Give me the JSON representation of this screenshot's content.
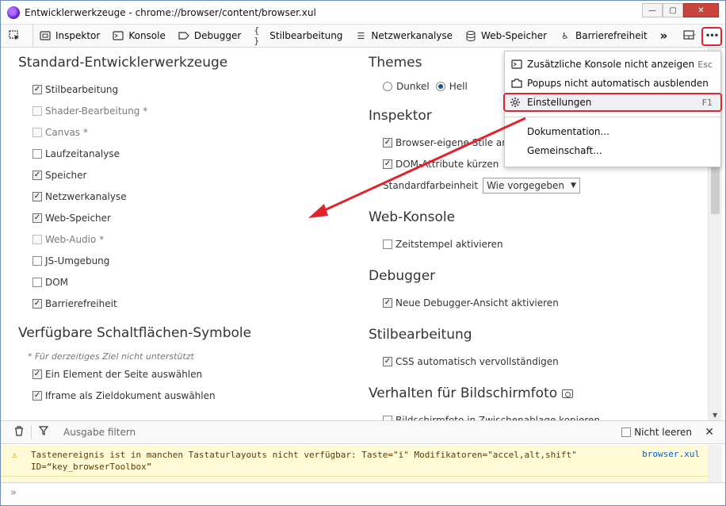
{
  "window": {
    "title": "Entwicklerwerkzeuge - chrome://browser/content/browser.xul",
    "min": "—",
    "max": "▢",
    "close": "✕"
  },
  "toolbar": {
    "tabs": [
      {
        "label": "Inspektor",
        "icon": "inspector-icon"
      },
      {
        "label": "Konsole",
        "icon": "console-icon"
      },
      {
        "label": "Debugger",
        "icon": "debugger-icon"
      },
      {
        "label": "Stilbearbeitung",
        "icon": "style-editor-icon"
      },
      {
        "label": "Netzwerkanalyse",
        "icon": "network-icon"
      },
      {
        "label": "Web-Speicher",
        "icon": "storage-icon"
      },
      {
        "label": "Barrierefreiheit",
        "icon": "accessibility-icon"
      }
    ],
    "overflow": "»",
    "menu_button": "•••"
  },
  "left": {
    "default_tools_title": "Standard-Entwicklerwerkzeuge",
    "default_tools": [
      {
        "label": "Stilbearbeitung",
        "checked": true,
        "disabled": false
      },
      {
        "label": "Shader-Bearbeitung *",
        "checked": false,
        "disabled": true
      },
      {
        "label": "Canvas *",
        "checked": false,
        "disabled": true
      },
      {
        "label": "Laufzeitanalyse",
        "checked": false,
        "disabled": false
      },
      {
        "label": "Speicher",
        "checked": true,
        "disabled": false
      },
      {
        "label": "Netzwerkanalyse",
        "checked": true,
        "disabled": false
      },
      {
        "label": "Web-Speicher",
        "checked": true,
        "disabled": false
      },
      {
        "label": "Web-Audio *",
        "checked": false,
        "disabled": true
      },
      {
        "label": "JS-Umgebung",
        "checked": false,
        "disabled": false
      },
      {
        "label": "DOM",
        "checked": false,
        "disabled": false
      },
      {
        "label": "Barrierefreiheit",
        "checked": true,
        "disabled": false
      }
    ],
    "buttons_title": "Verfügbare Schaltflächen-Symbole",
    "buttons_note": "* Für derzeitiges Ziel nicht unterstützt",
    "buttons": [
      {
        "label": "Ein Element der Seite auswählen",
        "checked": true
      },
      {
        "label": "Iframe als Zieldokument auswählen",
        "checked": true
      }
    ]
  },
  "right": {
    "themes_title": "Themes",
    "themes": [
      {
        "label": "Dunkel",
        "selected": false
      },
      {
        "label": "Hell",
        "selected": true
      }
    ],
    "inspector_title": "Inspektor",
    "inspector": [
      {
        "label": "Browser-eigene Stile anzeigen",
        "checked": true
      },
      {
        "label": "DOM-Attribute kürzen",
        "checked": true
      }
    ],
    "color_unit_label": "Standardfarbeinheit",
    "color_unit_value": "Wie vorgegeben",
    "webconsole_title": "Web-Konsole",
    "webconsole": [
      {
        "label": "Zeitstempel aktivieren",
        "checked": false
      }
    ],
    "debugger_title": "Debugger",
    "debugger": [
      {
        "label": "Neue Debugger-Ansicht aktivieren",
        "checked": true
      }
    ],
    "styleeditor_title": "Stilbearbeitung",
    "styleeditor": [
      {
        "label": "CSS automatisch vervollständigen",
        "checked": true
      }
    ],
    "screenshot_title": "Verhalten für Bildschirmfoto",
    "screenshot": [
      {
        "label": "Bildschirmfoto in Zwischenablage kopieren",
        "checked": false
      }
    ]
  },
  "menu": {
    "items": [
      {
        "label": "Zusätzliche Konsole nicht anzeigen",
        "key": "Esc",
        "icon": "split-console-icon"
      },
      {
        "label": "Popups nicht automatisch ausblenden",
        "key": "",
        "icon": "popup-icon"
      },
      {
        "label": "Einstellungen",
        "key": "F1",
        "icon": "gear-icon"
      }
    ],
    "links": [
      {
        "label": "Dokumentation..."
      },
      {
        "label": "Gemeinschaft..."
      }
    ]
  },
  "console": {
    "filter_placeholder": "Ausgabe filtern",
    "clear_option": "Nicht leeren",
    "warning_text": "Tastenereignis ist in manchen Tastaturlayouts nicht verfügbar: Taste=\"i\" Modifikatoren=\"accel,alt,shift\" ID=“key_browserToolbox”",
    "warning_source": "browser.xul",
    "prompt": "»"
  },
  "colors": {
    "highlight": "#e0242b",
    "warning_bg": "#fffbd6",
    "link": "#0060df"
  }
}
